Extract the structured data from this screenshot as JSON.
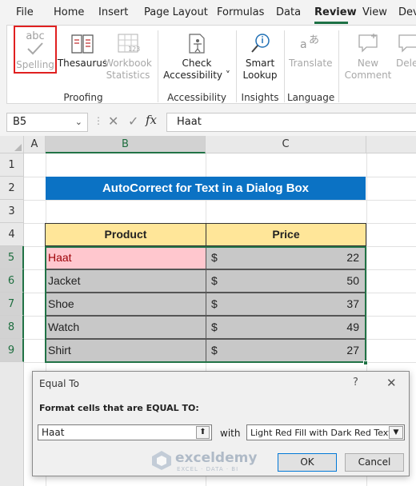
{
  "menu": {
    "items": [
      {
        "label": "File"
      },
      {
        "label": "Home"
      },
      {
        "label": "Insert"
      },
      {
        "label": "Page Layout"
      },
      {
        "label": "Formulas"
      },
      {
        "label": "Data"
      },
      {
        "label": "Review"
      },
      {
        "label": "View"
      },
      {
        "label": "Dev"
      }
    ],
    "active": "Review"
  },
  "ribbon": {
    "spelling_icon_text": "abc",
    "spelling": "Spelling",
    "thesaurus": "Thesaurus",
    "workbook_statistics_1": "Workbook",
    "workbook_statistics_2": "Statistics",
    "workbook_icon_text": "123",
    "check_accessibility_1": "Check",
    "check_accessibility_2": "Accessibility ˅",
    "smart_lookup_1": "Smart",
    "smart_lookup_2": "Lookup",
    "translate": "Translate",
    "new_comment_1": "New",
    "new_comment_2": "Comment",
    "delete": "Delet",
    "groups": {
      "proofing": "Proofing",
      "accessibility": "Accessibility",
      "insights": "Insights",
      "language": "Language"
    }
  },
  "formula_bar": {
    "name_box": "B5",
    "fx": "fx",
    "value": "Haat"
  },
  "sheet": {
    "columns": [
      "A",
      "B",
      "C"
    ],
    "rows": [
      "1",
      "2",
      "3",
      "4",
      "5",
      "6",
      "7",
      "8",
      "9"
    ],
    "title": "AutoCorrect for Text in a Dialog Box",
    "headers": {
      "product": "Product",
      "price": "Price"
    },
    "currency": "$",
    "data": [
      {
        "product": "Haat",
        "price": "22"
      },
      {
        "product": "Jacket",
        "price": "50"
      },
      {
        "product": "Shoe",
        "price": "37"
      },
      {
        "product": "Watch",
        "price": "49"
      },
      {
        "product": "Shirt",
        "price": "27"
      }
    ]
  },
  "dialog": {
    "title": "Equal To",
    "help": "?",
    "close": "✕",
    "label": "Format cells that are EQUAL TO:",
    "input_value": "Haat",
    "with_label": "with",
    "format_option": "Light Red Fill with Dark Red Text",
    "ok": "OK",
    "cancel": "Cancel"
  },
  "watermark": {
    "name": "exceldemy",
    "tagline": "EXCEL · DATA · BI"
  },
  "colors": {
    "excel_green": "#217346",
    "title_blue": "#0b72c4",
    "header_yellow": "#ffe699",
    "light_red_fill": "#ffc7ce",
    "dark_red_text": "#9c0006",
    "highlight_red": "#e02020"
  }
}
